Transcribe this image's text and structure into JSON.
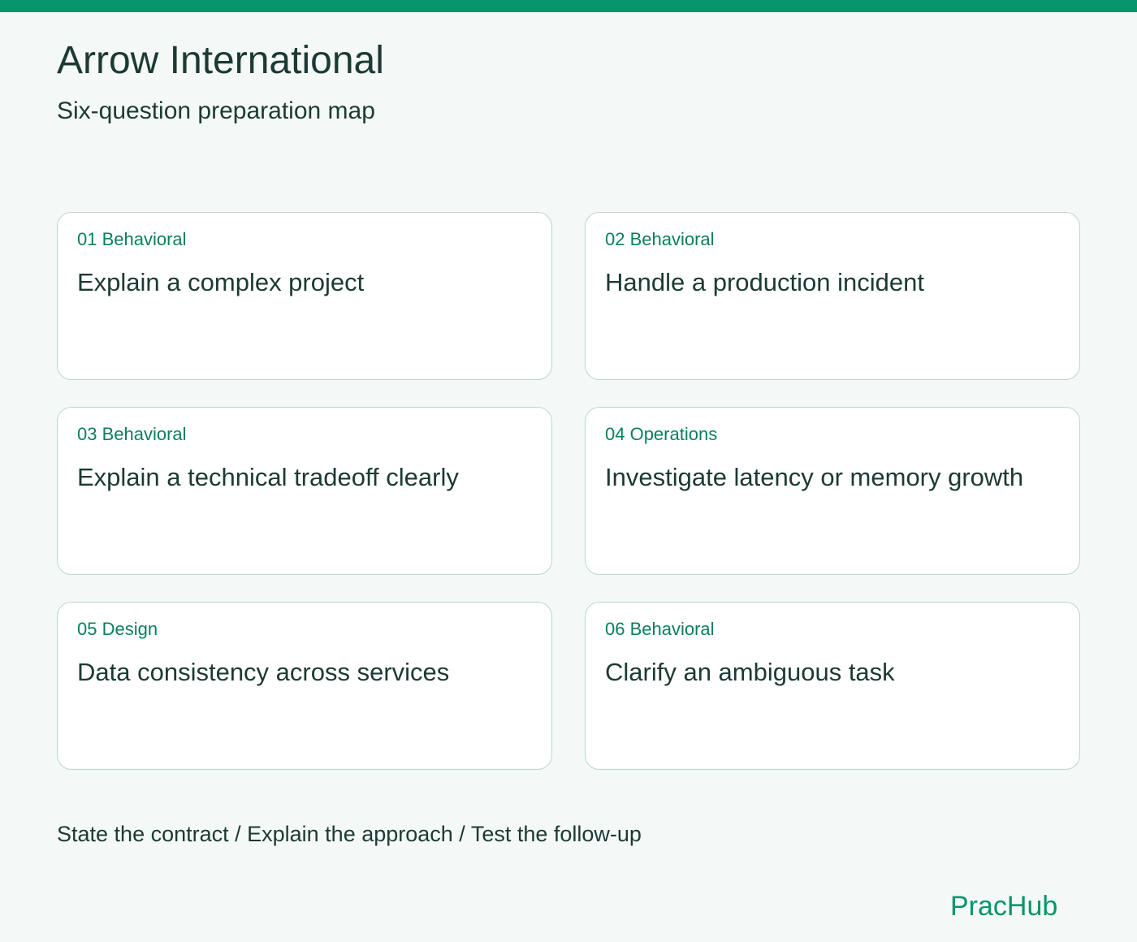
{
  "header": {
    "title": "Arrow International",
    "subtitle": "Six-question preparation map"
  },
  "cards": [
    {
      "tag": "01 Behavioral",
      "title": "Explain a complex project"
    },
    {
      "tag": "02 Behavioral",
      "title": "Handle a production incident"
    },
    {
      "tag": "03 Behavioral",
      "title": "Explain a technical tradeoff clearly"
    },
    {
      "tag": "04 Operations",
      "title": "Investigate latency or memory growth"
    },
    {
      "tag": "05 Design",
      "title": "Data consistency across services"
    },
    {
      "tag": "06 Behavioral",
      "title": "Clarify an ambiguous task"
    }
  ],
  "footer": {
    "steps": "State the contract / Explain the approach / Test the follow-up",
    "brand": "PracHub"
  },
  "colors": {
    "accent": "#07956b",
    "tag_text": "#0a7f5c",
    "text": "#1c3a33",
    "background": "#f4f8f6",
    "card_border": "#b9d8ce"
  }
}
